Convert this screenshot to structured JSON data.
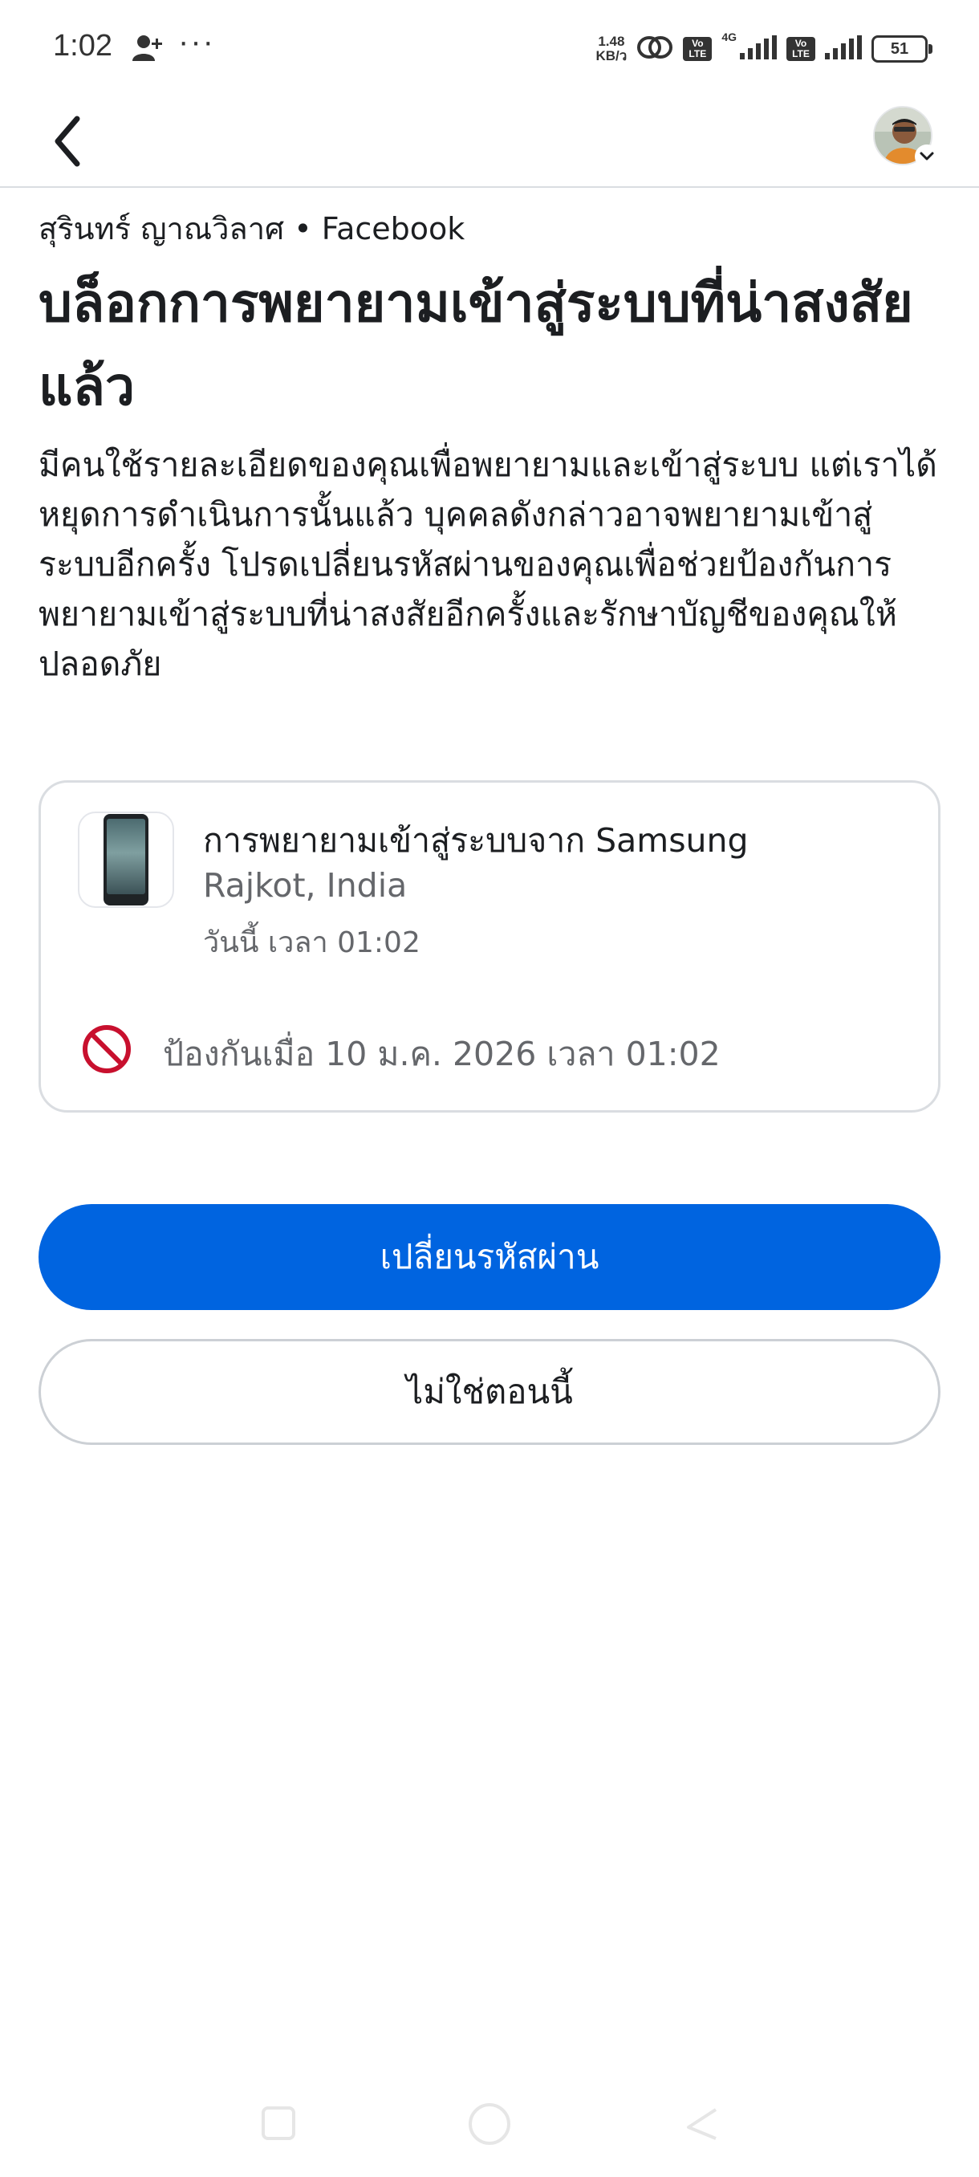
{
  "status_bar": {
    "time": "1:02",
    "dots": "···",
    "speed_value": "1.48",
    "speed_unit": "KB/ว",
    "volte_label": "Vo\nLTE",
    "network": "4G",
    "battery": "51"
  },
  "header": {
    "back_icon": "chevron-left-icon",
    "avatar_icon": "profile-avatar"
  },
  "content": {
    "account_name": "สุรินทร์ ญาณวิลาศ",
    "separator": " • ",
    "brand": "Facebook",
    "title": "บล็อกการพยายามเข้าสู่ระบบที่น่าสงสัยแล้ว",
    "body": "มีคนใช้รายละเอียดของคุณเพื่อพยายามและเข้าสู่ระบบ แต่เราได้หยุดการดำเนินการนั้นแล้ว บุคคลดังกล่าวอาจพยายามเข้าสู่ระบบอีกครั้ง โปรดเปลี่ยนรหัสผ่านของคุณเพื่อช่วยป้องกันการพยายามเข้าสู่ระบบที่น่าสงสัยอีกครั้งและรักษาบัญชีของคุณให้ปลอดภัย"
  },
  "login_attempt": {
    "device_icon": "phone-icon",
    "title_prefix": "การพยายามเข้าสู่ระบบจาก ",
    "device_name": "Samsung",
    "location": "Rajkot, India",
    "time": "วันนี้ เวลา 01:02",
    "blocked_icon": "blocked-icon",
    "blocked_text": "ป้องกันเมื่อ 10 ม.ค. 2026 เวลา 01:02"
  },
  "actions": {
    "primary_label": "เปลี่ยนรหัสผ่าน",
    "secondary_label": "ไม่ใช่ตอนนี้"
  },
  "colors": {
    "primary": "#0064e0",
    "blocked_red": "#c8102e",
    "muted_text": "#65676b",
    "border": "#dadde1"
  },
  "nav_bar": {
    "recents_icon": "recents-icon",
    "home_icon": "home-icon",
    "back_icon": "back-icon"
  }
}
